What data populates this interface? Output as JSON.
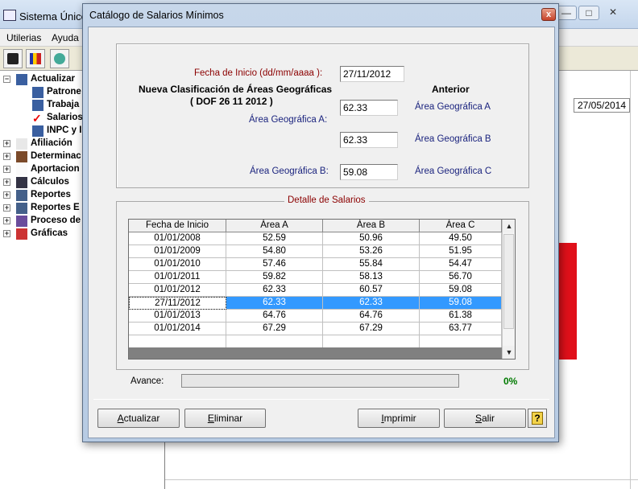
{
  "app": {
    "title": "Sistema Único",
    "menu": [
      "Utilerias",
      "Ayuda"
    ],
    "date": "27/05/2014",
    "tree": [
      {
        "label": "Actualizar",
        "icon": "people-icon",
        "expanded": true
      },
      {
        "label": "Patrone",
        "icon": "people-icon",
        "child": true
      },
      {
        "label": "Trabaja",
        "icon": "people-icon",
        "child": true
      },
      {
        "label": "Salarios",
        "icon": "checkmark-icon",
        "child": true
      },
      {
        "label": "INPC y I",
        "icon": "people-icon",
        "child": true
      },
      {
        "label": "Afiliación",
        "icon": "document-icon"
      },
      {
        "label": "Determinac",
        "icon": "calculator-icon"
      },
      {
        "label": "Aportacion",
        "icon": "blank-icon"
      },
      {
        "label": "Cálculos",
        "icon": "sigma-icon"
      },
      {
        "label": "Reportes",
        "icon": "folder-icon"
      },
      {
        "label": "Reportes E",
        "icon": "folder-icon"
      },
      {
        "label": "Proceso de",
        "icon": "process-icon"
      },
      {
        "label": "Gráficas",
        "icon": "bar-chart-icon"
      }
    ]
  },
  "dialog": {
    "title": "Catálogo de Salarios Mínimos",
    "close": "x",
    "fecha_label": "Fecha de Inicio (dd/mm/aaaa ):",
    "fecha_value": "27/11/2012",
    "nueva_line1": "Nueva Clasificación de Áreas Geográficas",
    "nueva_line2": "( DOF 26 11 2012 )",
    "anterior": "Anterior",
    "area_a_label": "Área Geográfica A:",
    "area_a_value": "62.33",
    "area_b_label": "Área Geográfica B:",
    "area_b_value": "59.08",
    "middle_value": "62.33",
    "prev_a": "Área Geográfica A",
    "prev_b": "Área Geográfica B",
    "prev_c": "Área Geográfica C",
    "detalle": "Detalle de Salarios",
    "columns": [
      "Fecha de Inicio",
      "Área A",
      "Área B",
      "Área C"
    ],
    "rows": [
      [
        "01/01/2008",
        "52.59",
        "50.96",
        "49.50"
      ],
      [
        "01/01/2009",
        "54.80",
        "53.26",
        "51.95"
      ],
      [
        "01/01/2010",
        "57.46",
        "55.84",
        "54.47"
      ],
      [
        "01/01/2011",
        "59.82",
        "58.13",
        "56.70"
      ],
      [
        "01/01/2012",
        "62.33",
        "60.57",
        "59.08"
      ],
      [
        "27/11/2012",
        "62.33",
        "62.33",
        "59.08"
      ],
      [
        "01/01/2013",
        "64.76",
        "64.76",
        "61.38"
      ],
      [
        "01/01/2014",
        "67.29",
        "67.29",
        "63.77"
      ]
    ],
    "selected_row": 5,
    "avance_label": "Avance:",
    "progress": 0,
    "progress_text": "0%",
    "buttons": {
      "actualizar_hot": "A",
      "actualizar_rest": "ctualizar",
      "eliminar_hot": "E",
      "eliminar_rest": "liminar",
      "imprimir_hot": "I",
      "imprimir_rest": "mprimir",
      "salir_hot": "S",
      "salir_rest": "alir",
      "help": "?"
    },
    "colors": {
      "selection": "#3399ff",
      "progress_text": "#007a00",
      "label_red": "#8b0000",
      "label_blue": "#1a237e"
    }
  }
}
